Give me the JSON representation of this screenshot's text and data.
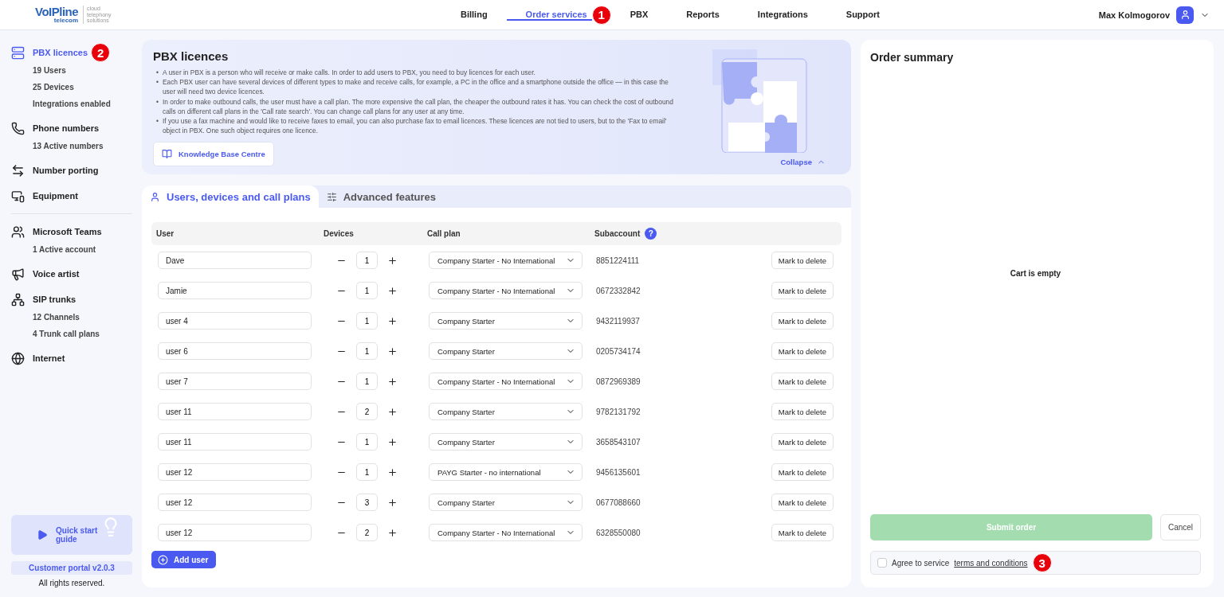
{
  "logo": {
    "name": "VoIPline",
    "sub": "telecom",
    "tagline": "cloud telephony solutions"
  },
  "nav": [
    {
      "label": "Billing",
      "selected": false
    },
    {
      "label": "Order services",
      "selected": true,
      "callout": "1"
    },
    {
      "label": "PBX",
      "selected": false
    },
    {
      "label": "Reports",
      "selected": false
    },
    {
      "label": "Integrations",
      "selected": false
    },
    {
      "label": "Support",
      "selected": false
    }
  ],
  "user": {
    "name": "Max Kolmogorov"
  },
  "sidebar": {
    "items": [
      {
        "label": "PBX licences",
        "selected": true,
        "callout": "2",
        "children": [
          {
            "label": "19 Users"
          },
          {
            "label": "25 Devices"
          },
          {
            "label": "Integrations enabled"
          }
        ]
      },
      {
        "label": "Phone numbers",
        "selected": false,
        "children": [
          {
            "label": "13 Active numbers"
          }
        ]
      },
      {
        "label": "Number porting",
        "selected": false
      },
      {
        "label": "Equipment",
        "selected": false,
        "divider_after": true
      },
      {
        "label": "Microsoft Teams",
        "selected": false,
        "children": [
          {
            "label": "1 Active account"
          }
        ]
      },
      {
        "label": "Voice artist",
        "selected": false
      },
      {
        "label": "SIP trunks",
        "selected": false,
        "children": [
          {
            "label": "12 Channels"
          },
          {
            "label": "4 Trunk call plans"
          }
        ]
      },
      {
        "label": "Internet",
        "selected": false
      }
    ],
    "guide": "Quick start guide",
    "version": "Customer portal v2.0.3",
    "rights": "All rights reserved."
  },
  "info": {
    "title": "PBX licences",
    "bullets": [
      "A user in PBX is a person who will receive or make calls. In order to add users to PBX, you need to buy licences for each user.",
      "Each PBX user can have several devices of different types to make and receive calls, for example, a PC in the office and a smartphone outside the office — in this case the user will need two device licences.",
      "In order to make outbound calls, the user must have a call plan. The more expensive the call plan, the cheaper the outbound rates it has. You can check the cost of outbound calls on different call plans in the 'Call rate search'. You can change call plans for any user at any time.",
      "If you use a fax machine and would like to receive faxes to email, you can also purchase fax to email licences. These licences are not tied to users, but to the 'Fax to email' object in PBX. One such object requires one licence."
    ],
    "marker": "•",
    "link": "Knowledge Base Centre",
    "collapse": "Collapse"
  },
  "tabs": [
    {
      "label": "Users, devices and call plans",
      "selected": true
    },
    {
      "label": "Advanced features",
      "selected": false
    }
  ],
  "table": {
    "columns": [
      "User",
      "Devices",
      "Call plan",
      "Subaccount"
    ],
    "help": "?",
    "rows": [
      {
        "user": "Dave",
        "devices": "1",
        "plan": "Company Starter - No International",
        "subaccount": "8851224111",
        "action": "Mark to delete"
      },
      {
        "user": "Jamie",
        "devices": "1",
        "plan": "Company Starter - No International",
        "subaccount": "0672332842",
        "action": "Mark to delete"
      },
      {
        "user": "user 4",
        "devices": "1",
        "plan": "Company Starter",
        "subaccount": "9432119937",
        "action": "Mark to delete"
      },
      {
        "user": "user 6",
        "devices": "1",
        "plan": "Company Starter",
        "subaccount": "0205734174",
        "action": "Mark to delete"
      },
      {
        "user": "user 7",
        "devices": "1",
        "plan": "Company Starter - No International",
        "subaccount": "0872969389",
        "action": "Mark to delete"
      },
      {
        "user": "user 11",
        "devices": "2",
        "plan": "Company Starter",
        "subaccount": "9782131792",
        "action": "Mark to delete"
      },
      {
        "user": "user 11",
        "devices": "1",
        "plan": "Company Starter",
        "subaccount": "3658543107",
        "action": "Mark to delete"
      },
      {
        "user": "user 12",
        "devices": "1",
        "plan": "PAYG Starter - no international",
        "subaccount": "9456135601",
        "action": "Mark to delete"
      },
      {
        "user": "user 12",
        "devices": "3",
        "plan": "Company Starter",
        "subaccount": "0677088660",
        "action": "Mark to delete"
      },
      {
        "user": "user 12",
        "devices": "2",
        "plan": "Company Starter - No International",
        "subaccount": "6328550080",
        "action": "Mark to delete"
      }
    ],
    "add": "Add user"
  },
  "summary": {
    "title": "Order summary",
    "empty": "Cart is empty",
    "submit": {
      "label": "Submit order",
      "disabled": true
    },
    "cancel": "Cancel",
    "agree": {
      "text": "Agree to service",
      "link": "terms and conditions",
      "checked": false,
      "callout": "3"
    }
  }
}
